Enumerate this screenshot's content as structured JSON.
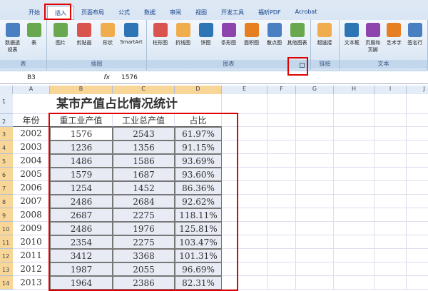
{
  "tabs": [
    "开始",
    "插入",
    "页面布局",
    "公式",
    "数据",
    "审阅",
    "视图",
    "开发工具",
    "福昕PDF",
    "Acrobat"
  ],
  "groups": [
    {
      "label": "表",
      "items": [
        "数据透视表",
        "表"
      ]
    },
    {
      "label": "插图",
      "items": [
        "图片",
        "剪贴画",
        "形状",
        "SmartArt"
      ]
    },
    {
      "label": "图表",
      "items": [
        "柱形图",
        "折线图",
        "饼图",
        "条形图",
        "面积图",
        "散点图",
        "其他图表"
      ]
    },
    {
      "label": "链接",
      "items": [
        "超链接"
      ]
    },
    {
      "label": "文本",
      "items": [
        "文本框",
        "页眉和页脚",
        "艺术字",
        "签名行"
      ]
    }
  ],
  "name_box": "B3",
  "formula": "1576",
  "fx": "fx",
  "columns": [
    "A",
    "B",
    "C",
    "D",
    "E",
    "F",
    "G",
    "H",
    "I",
    "J"
  ],
  "title": "某市产值占比情况统计",
  "headers": [
    "年份",
    "重工业产值",
    "工业总产值",
    "占比"
  ],
  "rows": [
    [
      "2002",
      "1576",
      "2543",
      "61.97%"
    ],
    [
      "2003",
      "1236",
      "1356",
      "91.15%"
    ],
    [
      "2004",
      "1486",
      "1586",
      "93.69%"
    ],
    [
      "2005",
      "1579",
      "1687",
      "93.60%"
    ],
    [
      "2006",
      "1254",
      "1452",
      "86.36%"
    ],
    [
      "2007",
      "2486",
      "2684",
      "92.62%"
    ],
    [
      "2008",
      "2687",
      "2275",
      "118.11%"
    ],
    [
      "2009",
      "2486",
      "1976",
      "125.81%"
    ],
    [
      "2010",
      "2354",
      "2275",
      "103.47%"
    ],
    [
      "2011",
      "3412",
      "3368",
      "101.31%"
    ],
    [
      "2012",
      "1987",
      "2055",
      "96.69%"
    ],
    [
      "2013",
      "1964",
      "2386",
      "82.31%"
    ]
  ]
}
